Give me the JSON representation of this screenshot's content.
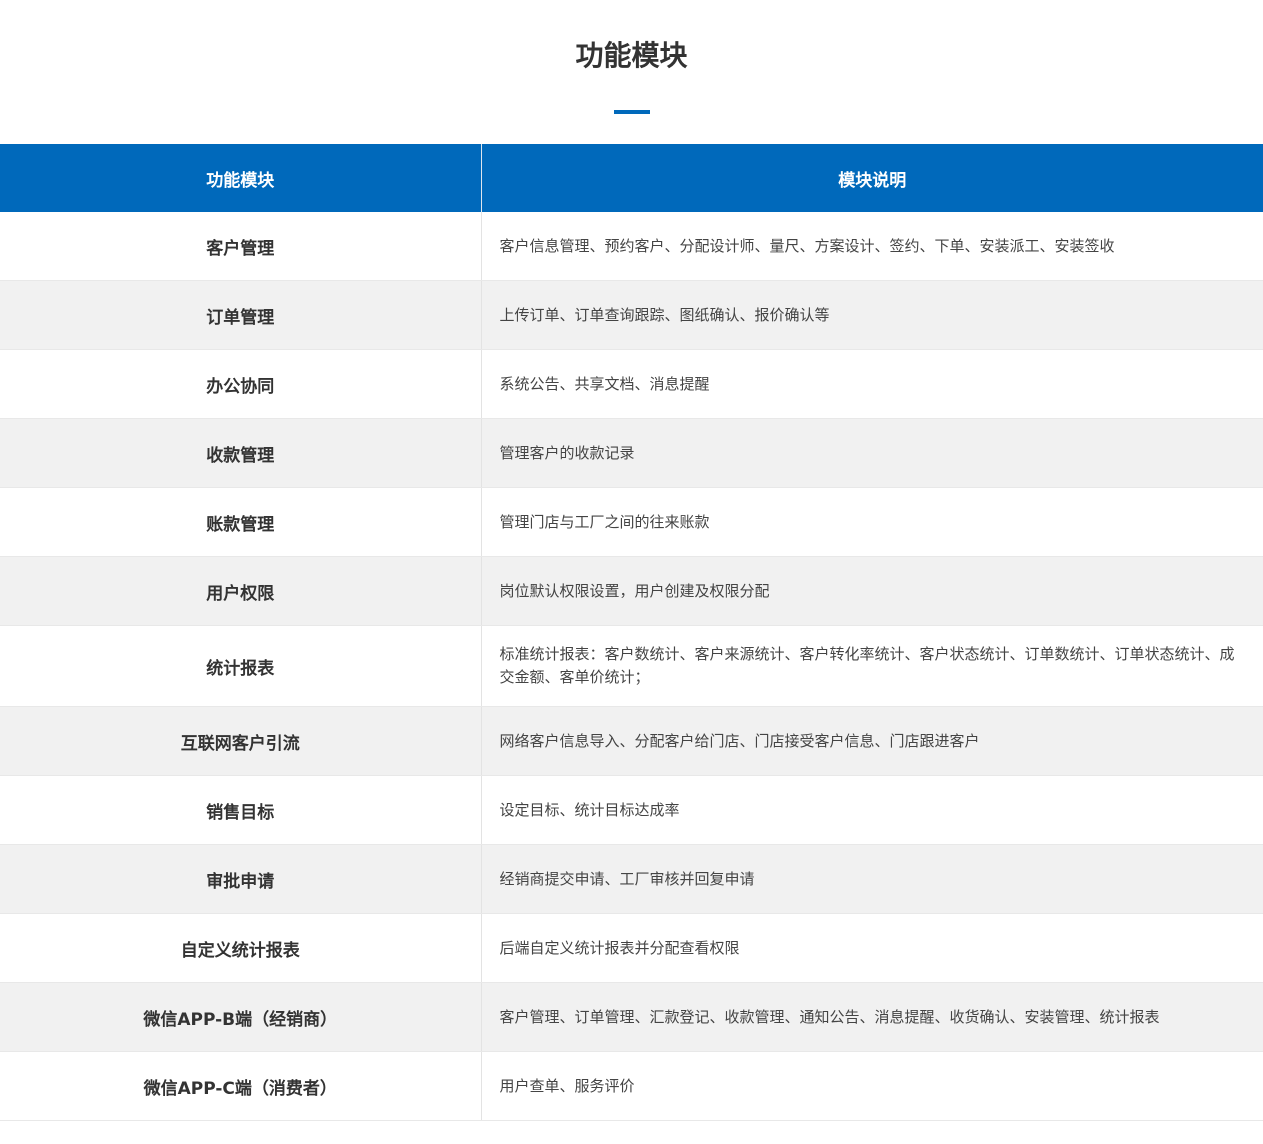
{
  "title": "功能模块",
  "colors": {
    "accent": "#0069bb",
    "stripe": "#f1f1f1"
  },
  "table": {
    "headers": [
      "功能模块",
      "模块说明"
    ],
    "rows": [
      {
        "name": "客户管理",
        "desc": "客户信息管理、预约客户、分配设计师、量尺、方案设计、签约、下单、安装派工、安装签收"
      },
      {
        "name": "订单管理",
        "desc": "上传订单、订单查询跟踪、图纸确认、报价确认等"
      },
      {
        "name": "办公协同",
        "desc": "系统公告、共享文档、消息提醒"
      },
      {
        "name": "收款管理",
        "desc": "管理客户的收款记录"
      },
      {
        "name": "账款管理",
        "desc": "管理门店与工厂之间的往来账款"
      },
      {
        "name": "用户权限",
        "desc": "岗位默认权限设置，用户创建及权限分配"
      },
      {
        "name": "统计报表",
        "desc": "标准统计报表：客户数统计、客户来源统计、客户转化率统计、客户状态统计、订单数统计、订单状态统计、成交金额、客单价统计；"
      },
      {
        "name": "互联网客户引流",
        "desc": "网络客户信息导入、分配客户给门店、门店接受客户信息、门店跟进客户"
      },
      {
        "name": "销售目标",
        "desc": "设定目标、统计目标达成率"
      },
      {
        "name": "审批申请",
        "desc": "经销商提交申请、工厂审核并回复申请"
      },
      {
        "name": "自定义统计报表",
        "desc": "后端自定义统计报表并分配查看权限"
      },
      {
        "name": "微信APP-B端（经销商）",
        "desc": "客户管理、订单管理、汇款登记、收款管理、通知公告、消息提醒、收货确认、安装管理、统计报表"
      },
      {
        "name": "微信APP-C端（消费者）",
        "desc": "用户查单、服务评价"
      }
    ]
  }
}
